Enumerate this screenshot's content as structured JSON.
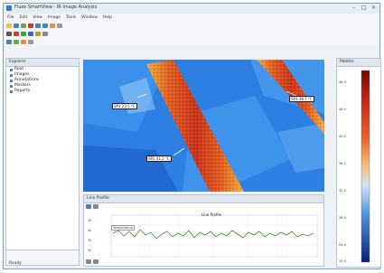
{
  "window": {
    "title": "Fluke SmartView - IR Image Analysis"
  },
  "menu": [
    "File",
    "Edit",
    "View",
    "Image",
    "Tools",
    "Window",
    "Help"
  ],
  "panels": {
    "left_title": "Explorer",
    "tree_items": [
      "Root",
      "Images",
      "Annotations",
      "Markers",
      "Reports"
    ],
    "left_footer": "Ready",
    "bottom_title": "Line Profile",
    "graph_title": "Line Profile",
    "graph_legend": "Temperature",
    "right_title": "Palette"
  },
  "markers": {
    "m1": "SP1 23.5 °C",
    "m2": "SP2 41.2 °C",
    "m3": "SP3 38.7 °C"
  },
  "colorbar_labels": [
    "48.0",
    "44.0",
    "40.0",
    "36.0",
    "32.0",
    "28.0",
    "24.0",
    "20.0"
  ],
  "colors": {
    "accent": "#3a78c2",
    "hot": "#d0391f",
    "cold": "#2b7be0"
  }
}
